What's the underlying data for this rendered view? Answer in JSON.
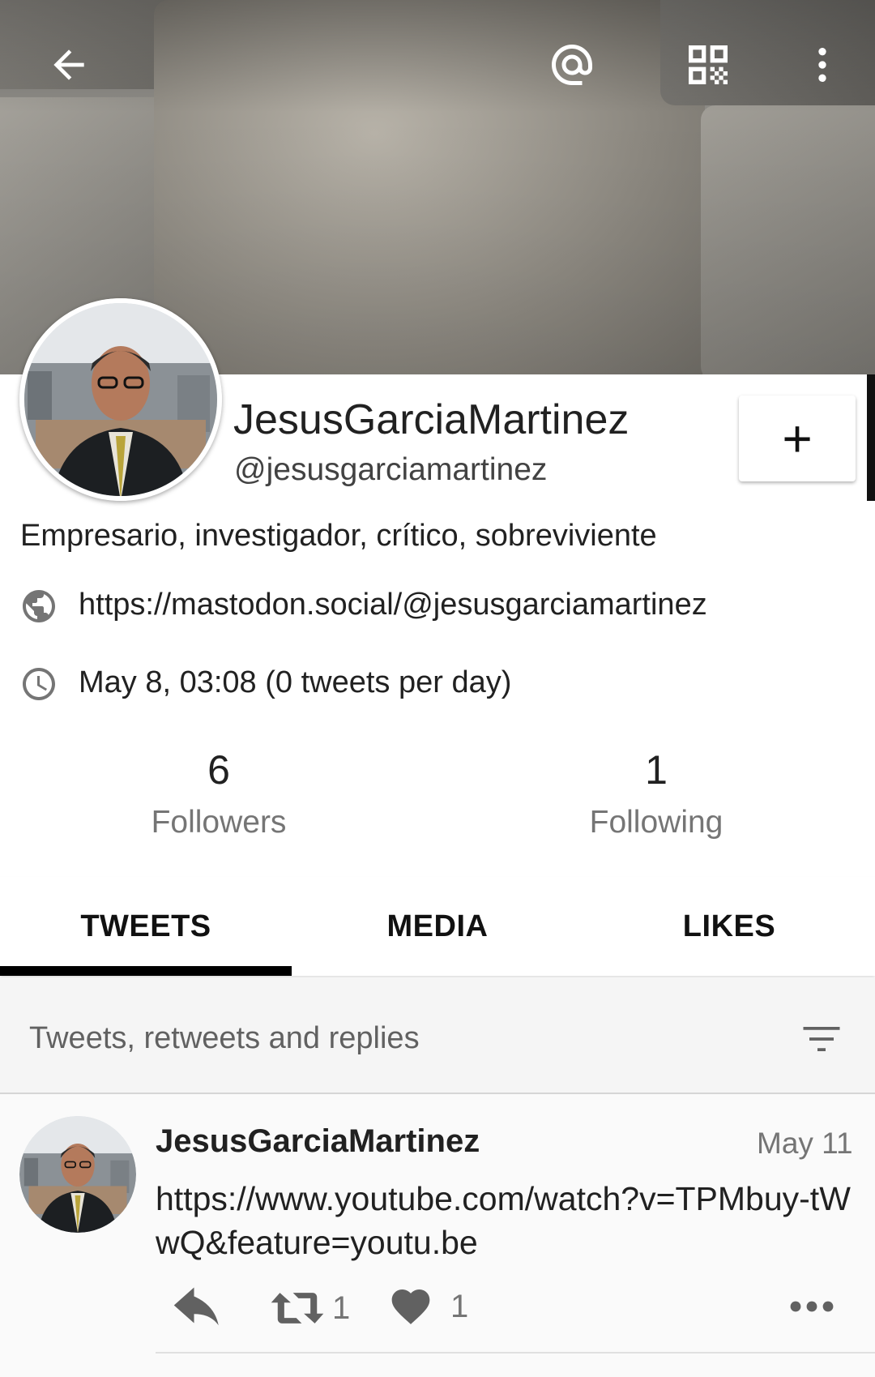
{
  "toolbar": {
    "back_icon": "arrow-left-icon",
    "mention_icon": "at-sign-icon",
    "qr_icon": "qr-code-icon",
    "menu_icon": "more-vertical-icon"
  },
  "profile": {
    "display_name": "JesusGarciaMartinez",
    "handle": "@jesusgarciamartinez",
    "bio": "Empresario, investigador, crítico, sobreviviente",
    "website": "https://mastodon.social/@jesusgarciamartinez",
    "joined": "May 8, 03:08 (0 tweets per day)",
    "follow_label": "+"
  },
  "stats": {
    "followers_count": "6",
    "followers_label": "Followers",
    "following_count": "1",
    "following_label": "Following"
  },
  "tabs": [
    {
      "label": "TWEETS",
      "active": true
    },
    {
      "label": "MEDIA",
      "active": false
    },
    {
      "label": "LIKES",
      "active": false
    }
  ],
  "filter": {
    "label": "Tweets, retweets and replies",
    "icon": "filter-icon"
  },
  "tweets": [
    {
      "author": "JesusGarciaMartinez",
      "date": "May 11",
      "text": "https://www.youtube.com/watch?v=TPMbuy-tWwQ&feature=youtu.be",
      "retweet_count": "1",
      "like_count": "1"
    }
  ],
  "colors": {
    "accent": "#000000",
    "text_primary": "#212121",
    "text_secondary": "#757575"
  }
}
